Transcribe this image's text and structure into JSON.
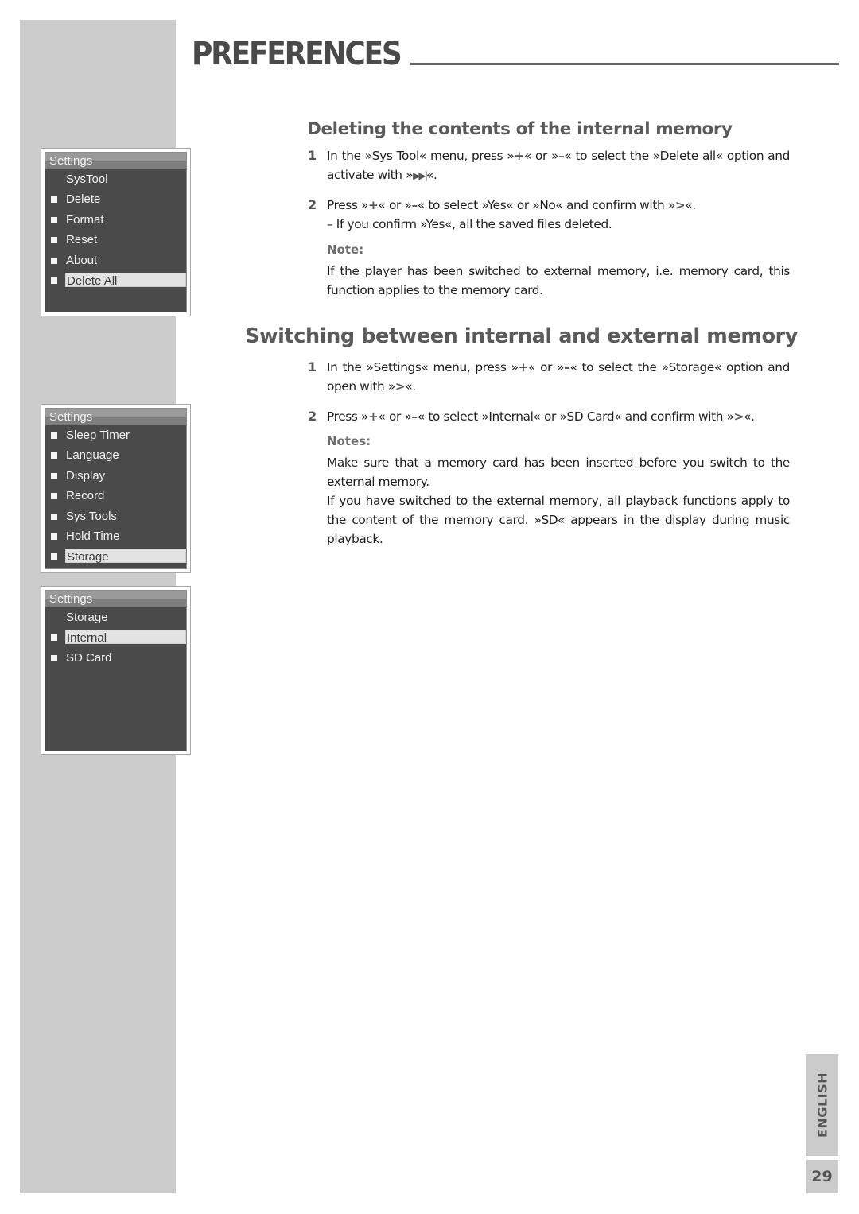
{
  "page": {
    "title": "PREFERENCES",
    "language_tab": "ENGLISH",
    "page_number": "29"
  },
  "menus": [
    {
      "header": "Settings",
      "items": [
        {
          "label": "SysTool",
          "bullet": false,
          "selected": false
        },
        {
          "label": "Delete",
          "bullet": true,
          "selected": false
        },
        {
          "label": "Format",
          "bullet": true,
          "selected": false
        },
        {
          "label": "Reset",
          "bullet": true,
          "selected": false
        },
        {
          "label": "About",
          "bullet": true,
          "selected": false
        },
        {
          "label": "Delete All",
          "bullet": true,
          "selected": true
        }
      ]
    },
    {
      "header": "Settings",
      "items": [
        {
          "label": "Sleep Timer",
          "bullet": true,
          "selected": false
        },
        {
          "label": "Language",
          "bullet": true,
          "selected": false
        },
        {
          "label": "Display",
          "bullet": true,
          "selected": false
        },
        {
          "label": "Record",
          "bullet": true,
          "selected": false
        },
        {
          "label": "Sys Tools",
          "bullet": true,
          "selected": false
        },
        {
          "label": "Hold Time",
          "bullet": true,
          "selected": false
        },
        {
          "label": "Storage",
          "bullet": true,
          "selected": true
        }
      ]
    },
    {
      "header": "Settings",
      "items": [
        {
          "label": "Storage",
          "bullet": false,
          "selected": false
        },
        {
          "label": "Internal",
          "bullet": true,
          "selected": true
        },
        {
          "label": "SD Card",
          "bullet": true,
          "selected": false
        }
      ]
    }
  ],
  "section1": {
    "heading": "Deleting the contents of the internal memory",
    "step1": {
      "num": "1",
      "text_a": "In the »Sys Tool« menu, press »",
      "plus": "+",
      "text_b": "« or »",
      "minus": "–",
      "text_c": "« to select the »Delete all« option and activate with »",
      "button_icon": "▶▶|",
      "text_d": "«."
    },
    "step2": {
      "num": "2",
      "text_a": "Press »",
      "plus": "+",
      "text_b": "« or »",
      "minus": "–",
      "text_c": "« to select »Yes« or »No« and confirm with »",
      "button_icon": ">",
      "text_d": "«.",
      "sub": "– If you confirm »Yes«, all the saved files deleted."
    },
    "note_label": "Note:",
    "note_text": "If the player has been switched to external memory, i.e. memory card, this function applies to the memory card."
  },
  "section2": {
    "heading": "Switching between internal and external memory",
    "step1": {
      "num": "1",
      "text_a": "In the »Settings« menu, press »",
      "plus": "+",
      "text_b": "« or »",
      "minus": "–",
      "text_c": "« to select the »Storage« option and open with »",
      "button_icon": ">",
      "text_d": "«."
    },
    "step2": {
      "num": "2",
      "text_a": "Press »",
      "plus": "+",
      "text_b": "« or »",
      "minus": "–",
      "text_c": "« to select »Internal« or »SD Card« and confirm with »",
      "button_icon": ">",
      "text_d": "«."
    },
    "notes_label": "Notes:",
    "note1": "Make sure that a memory card has been inserted before you switch to the external memory.",
    "note2": "If you have switched to the external memory, all playback functions apply to the content of the memory card. »SD« appears in the display during music playback."
  }
}
